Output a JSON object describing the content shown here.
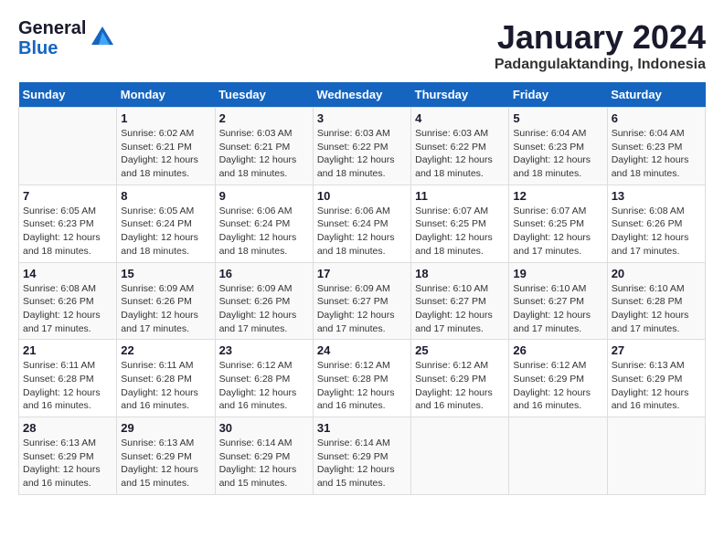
{
  "logo": {
    "general": "General",
    "blue": "Blue"
  },
  "title": "January 2024",
  "subtitle": "Padangulaktanding, Indonesia",
  "days_header": [
    "Sunday",
    "Monday",
    "Tuesday",
    "Wednesday",
    "Thursday",
    "Friday",
    "Saturday"
  ],
  "weeks": [
    [
      {
        "day": "",
        "info": ""
      },
      {
        "day": "1",
        "info": "Sunrise: 6:02 AM\nSunset: 6:21 PM\nDaylight: 12 hours\nand 18 minutes."
      },
      {
        "day": "2",
        "info": "Sunrise: 6:03 AM\nSunset: 6:21 PM\nDaylight: 12 hours\nand 18 minutes."
      },
      {
        "day": "3",
        "info": "Sunrise: 6:03 AM\nSunset: 6:22 PM\nDaylight: 12 hours\nand 18 minutes."
      },
      {
        "day": "4",
        "info": "Sunrise: 6:03 AM\nSunset: 6:22 PM\nDaylight: 12 hours\nand 18 minutes."
      },
      {
        "day": "5",
        "info": "Sunrise: 6:04 AM\nSunset: 6:23 PM\nDaylight: 12 hours\nand 18 minutes."
      },
      {
        "day": "6",
        "info": "Sunrise: 6:04 AM\nSunset: 6:23 PM\nDaylight: 12 hours\nand 18 minutes."
      }
    ],
    [
      {
        "day": "7",
        "info": "Sunrise: 6:05 AM\nSunset: 6:23 PM\nDaylight: 12 hours\nand 18 minutes."
      },
      {
        "day": "8",
        "info": "Sunrise: 6:05 AM\nSunset: 6:24 PM\nDaylight: 12 hours\nand 18 minutes."
      },
      {
        "day": "9",
        "info": "Sunrise: 6:06 AM\nSunset: 6:24 PM\nDaylight: 12 hours\nand 18 minutes."
      },
      {
        "day": "10",
        "info": "Sunrise: 6:06 AM\nSunset: 6:24 PM\nDaylight: 12 hours\nand 18 minutes."
      },
      {
        "day": "11",
        "info": "Sunrise: 6:07 AM\nSunset: 6:25 PM\nDaylight: 12 hours\nand 18 minutes."
      },
      {
        "day": "12",
        "info": "Sunrise: 6:07 AM\nSunset: 6:25 PM\nDaylight: 12 hours\nand 17 minutes."
      },
      {
        "day": "13",
        "info": "Sunrise: 6:08 AM\nSunset: 6:26 PM\nDaylight: 12 hours\nand 17 minutes."
      }
    ],
    [
      {
        "day": "14",
        "info": "Sunrise: 6:08 AM\nSunset: 6:26 PM\nDaylight: 12 hours\nand 17 minutes."
      },
      {
        "day": "15",
        "info": "Sunrise: 6:09 AM\nSunset: 6:26 PM\nDaylight: 12 hours\nand 17 minutes."
      },
      {
        "day": "16",
        "info": "Sunrise: 6:09 AM\nSunset: 6:26 PM\nDaylight: 12 hours\nand 17 minutes."
      },
      {
        "day": "17",
        "info": "Sunrise: 6:09 AM\nSunset: 6:27 PM\nDaylight: 12 hours\nand 17 minutes."
      },
      {
        "day": "18",
        "info": "Sunrise: 6:10 AM\nSunset: 6:27 PM\nDaylight: 12 hours\nand 17 minutes."
      },
      {
        "day": "19",
        "info": "Sunrise: 6:10 AM\nSunset: 6:27 PM\nDaylight: 12 hours\nand 17 minutes."
      },
      {
        "day": "20",
        "info": "Sunrise: 6:10 AM\nSunset: 6:28 PM\nDaylight: 12 hours\nand 17 minutes."
      }
    ],
    [
      {
        "day": "21",
        "info": "Sunrise: 6:11 AM\nSunset: 6:28 PM\nDaylight: 12 hours\nand 16 minutes."
      },
      {
        "day": "22",
        "info": "Sunrise: 6:11 AM\nSunset: 6:28 PM\nDaylight: 12 hours\nand 16 minutes."
      },
      {
        "day": "23",
        "info": "Sunrise: 6:12 AM\nSunset: 6:28 PM\nDaylight: 12 hours\nand 16 minutes."
      },
      {
        "day": "24",
        "info": "Sunrise: 6:12 AM\nSunset: 6:28 PM\nDaylight: 12 hours\nand 16 minutes."
      },
      {
        "day": "25",
        "info": "Sunrise: 6:12 AM\nSunset: 6:29 PM\nDaylight: 12 hours\nand 16 minutes."
      },
      {
        "day": "26",
        "info": "Sunrise: 6:12 AM\nSunset: 6:29 PM\nDaylight: 12 hours\nand 16 minutes."
      },
      {
        "day": "27",
        "info": "Sunrise: 6:13 AM\nSunset: 6:29 PM\nDaylight: 12 hours\nand 16 minutes."
      }
    ],
    [
      {
        "day": "28",
        "info": "Sunrise: 6:13 AM\nSunset: 6:29 PM\nDaylight: 12 hours\nand 16 minutes."
      },
      {
        "day": "29",
        "info": "Sunrise: 6:13 AM\nSunset: 6:29 PM\nDaylight: 12 hours\nand 15 minutes."
      },
      {
        "day": "30",
        "info": "Sunrise: 6:14 AM\nSunset: 6:29 PM\nDaylight: 12 hours\nand 15 minutes."
      },
      {
        "day": "31",
        "info": "Sunrise: 6:14 AM\nSunset: 6:29 PM\nDaylight: 12 hours\nand 15 minutes."
      },
      {
        "day": "",
        "info": ""
      },
      {
        "day": "",
        "info": ""
      },
      {
        "day": "",
        "info": ""
      }
    ]
  ]
}
